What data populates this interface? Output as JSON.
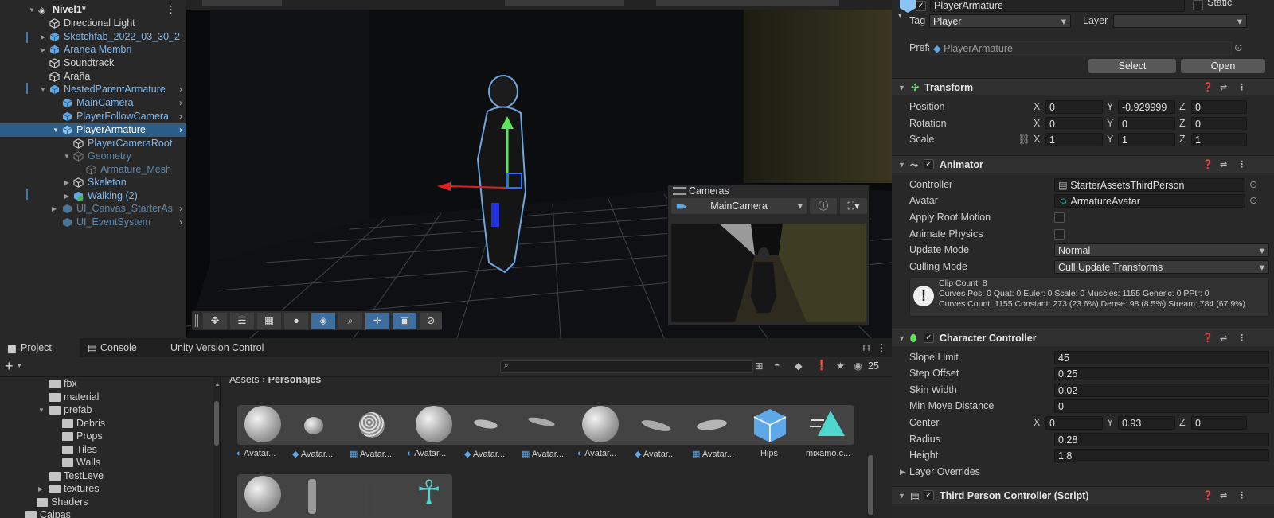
{
  "hierarchy": {
    "scene_name": "Nivel1*",
    "items": [
      {
        "label": "Directional Light"
      },
      {
        "label": "Sketchfab_2022_03_30_2"
      },
      {
        "label": "Aranea Membri"
      },
      {
        "label": "Soundtrack"
      },
      {
        "label": "Araña"
      },
      {
        "label": "NestedParentArmature"
      },
      {
        "label": "MainCamera"
      },
      {
        "label": "PlayerFollowCamera"
      },
      {
        "label": "PlayerArmature"
      },
      {
        "label": "PlayerCameraRoot"
      },
      {
        "label": "Geometry"
      },
      {
        "label": "Armature_Mesh"
      },
      {
        "label": "Skeleton"
      },
      {
        "label": "Walking (2)"
      },
      {
        "label": "UI_Canvas_StarterAs"
      },
      {
        "label": "UI_EventSystem"
      }
    ]
  },
  "camera_overlay": {
    "title": "Cameras",
    "camera": "MainCamera"
  },
  "inspector": {
    "object_name": "PlayerArmature",
    "static_label": "Static",
    "tag_label": "Tag",
    "tag_value": "Player",
    "layer_label": "Layer",
    "layer_value": "",
    "prefab_label": "Prefab",
    "prefab_value": "PlayerArmature",
    "select_btn": "Select",
    "open_btn": "Open",
    "transform": {
      "title": "Transform",
      "position_label": "Position",
      "pos": {
        "x": "0",
        "y": "-0.929999",
        "z": "0"
      },
      "rotation_label": "Rotation",
      "rot": {
        "x": "0",
        "y": "0",
        "z": "0"
      },
      "scale_label": "Scale",
      "scale": {
        "x": "1",
        "y": "1",
        "z": "1"
      }
    },
    "axes": {
      "x": "X",
      "y": "Y",
      "z": "Z"
    },
    "animator": {
      "title": "Animator",
      "controller_label": "Controller",
      "controller_value": "StarterAssetsThirdPerson",
      "avatar_label": "Avatar",
      "avatar_value": "ArmatureAvatar",
      "apply_root_label": "Apply Root Motion",
      "animate_physics_label": "Animate Physics",
      "update_mode_label": "Update Mode",
      "update_mode_value": "Normal",
      "culling_mode_label": "Culling Mode",
      "culling_mode_value": "Cull Update Transforms",
      "info1": "Clip Count: 8",
      "info2": "Curves Pos: 0 Quat: 0 Euler: 0 Scale: 0 Muscles: 1155 Generic: 0 PPtr: 0",
      "info3": "Curves Count: 1155 Constant: 273 (23.6%) Dense: 98 (8.5%) Stream: 784 (67.9%)"
    },
    "character_controller": {
      "title": "Character Controller",
      "slope_label": "Slope Limit",
      "slope_value": "45",
      "step_label": "Step Offset",
      "step_value": "0.25",
      "skin_label": "Skin Width",
      "skin_value": "0.02",
      "minmove_label": "Min Move Distance",
      "minmove_value": "0",
      "center_label": "Center",
      "center": {
        "x": "0",
        "y": "0.93",
        "z": "0"
      },
      "radius_label": "Radius",
      "radius_value": "0.28",
      "height_label": "Height",
      "height_value": "1.8",
      "layer_overrides_label": "Layer Overrides"
    },
    "third_person": {
      "title": "Third Person Controller (Script)"
    }
  },
  "project": {
    "tabs": [
      "Project",
      "Console",
      "Unity Version Control"
    ],
    "search_count": "25",
    "tree": [
      {
        "label": "fbx"
      },
      {
        "label": "material"
      },
      {
        "label": "prefab"
      },
      {
        "label": "Debris"
      },
      {
        "label": "Props"
      },
      {
        "label": "Tiles"
      },
      {
        "label": "Walls"
      },
      {
        "label": "TestLeve"
      },
      {
        "label": "textures"
      },
      {
        "label": "Shaders"
      },
      {
        "label": "Caipas"
      }
    ],
    "breadcrumb": {
      "root": "Assets",
      "current": "Personajes"
    },
    "assets": [
      {
        "label": "Avatar..."
      },
      {
        "label": "Avatar..."
      },
      {
        "label": "Avatar..."
      },
      {
        "label": "Avatar..."
      },
      {
        "label": "Avatar..."
      },
      {
        "label": "Avatar..."
      },
      {
        "label": "Avatar..."
      },
      {
        "label": "Avatar..."
      },
      {
        "label": "Avatar..."
      },
      {
        "label": "Hips"
      },
      {
        "label": "mixamo.c..."
      }
    ]
  },
  "colors": {
    "selection": "#2c5d87",
    "accent_blue": "#7fb8ef",
    "gizmo_green": "#5ee65e",
    "gizmo_red": "#e02020"
  }
}
